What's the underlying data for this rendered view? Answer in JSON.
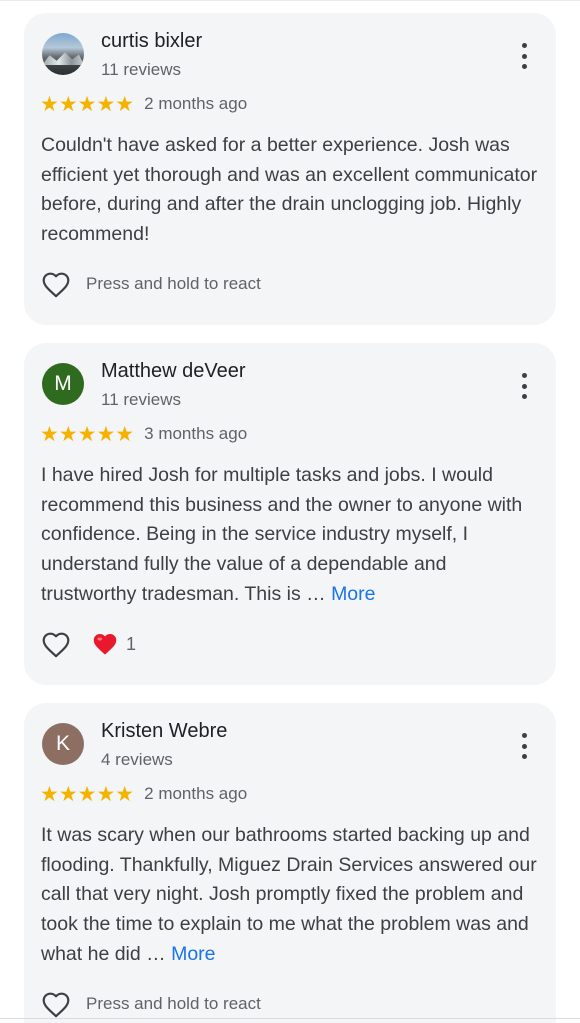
{
  "colors": {
    "card_background": "#f4f5f7",
    "star": "#f5b301",
    "link": "#1a73e8",
    "secondary_text": "#5f6368",
    "heart_reaction": "#e8192c"
  },
  "reviews": [
    {
      "author": "curtis bixler",
      "avatar": {
        "type": "photo",
        "letter": ""
      },
      "review_count": "11 reviews",
      "rating": 5,
      "stars_text": "★★★★★",
      "date": "2 months ago",
      "text": "Couldn't have asked for a better experience. Josh was efficient yet thorough and was an excellent communicator before, during and after the drain unclogging job. Highly recommend!",
      "more_label": "",
      "react_label": "Press and hold to react",
      "reaction_count": ""
    },
    {
      "author": "Matthew deVeer",
      "avatar": {
        "type": "letter",
        "letter": "M",
        "color": "#2f6b1f"
      },
      "review_count": "11 reviews",
      "rating": 5,
      "stars_text": "★★★★★",
      "date": "3 months ago",
      "text": "I have hired Josh for multiple tasks and jobs. I would recommend this business and the owner to anyone with confidence. Being in the service industry myself, I understand fully the value of a dependable and trustworthy tradesman. This is … ",
      "more_label": "More",
      "react_label": "",
      "reaction_count": "1"
    },
    {
      "author": "Kristen Webre",
      "avatar": {
        "type": "letter",
        "letter": "K",
        "color": "#8d6e63"
      },
      "review_count": "4 reviews",
      "rating": 5,
      "stars_text": "★★★★★",
      "date": "2 months ago",
      "text": "It was scary when our bathrooms started backing up and flooding. Thankfully, Miguez Drain Services answered our call that very night. Josh promptly fixed the problem and took the time to explain to me what the problem was and what he did … ",
      "more_label": "More",
      "react_label": "Press and hold to react",
      "reaction_count": ""
    }
  ],
  "icons": {
    "like": "heart-outline-icon",
    "reaction": "red-heart-emoji-icon",
    "menu": "more-vert-icon"
  }
}
